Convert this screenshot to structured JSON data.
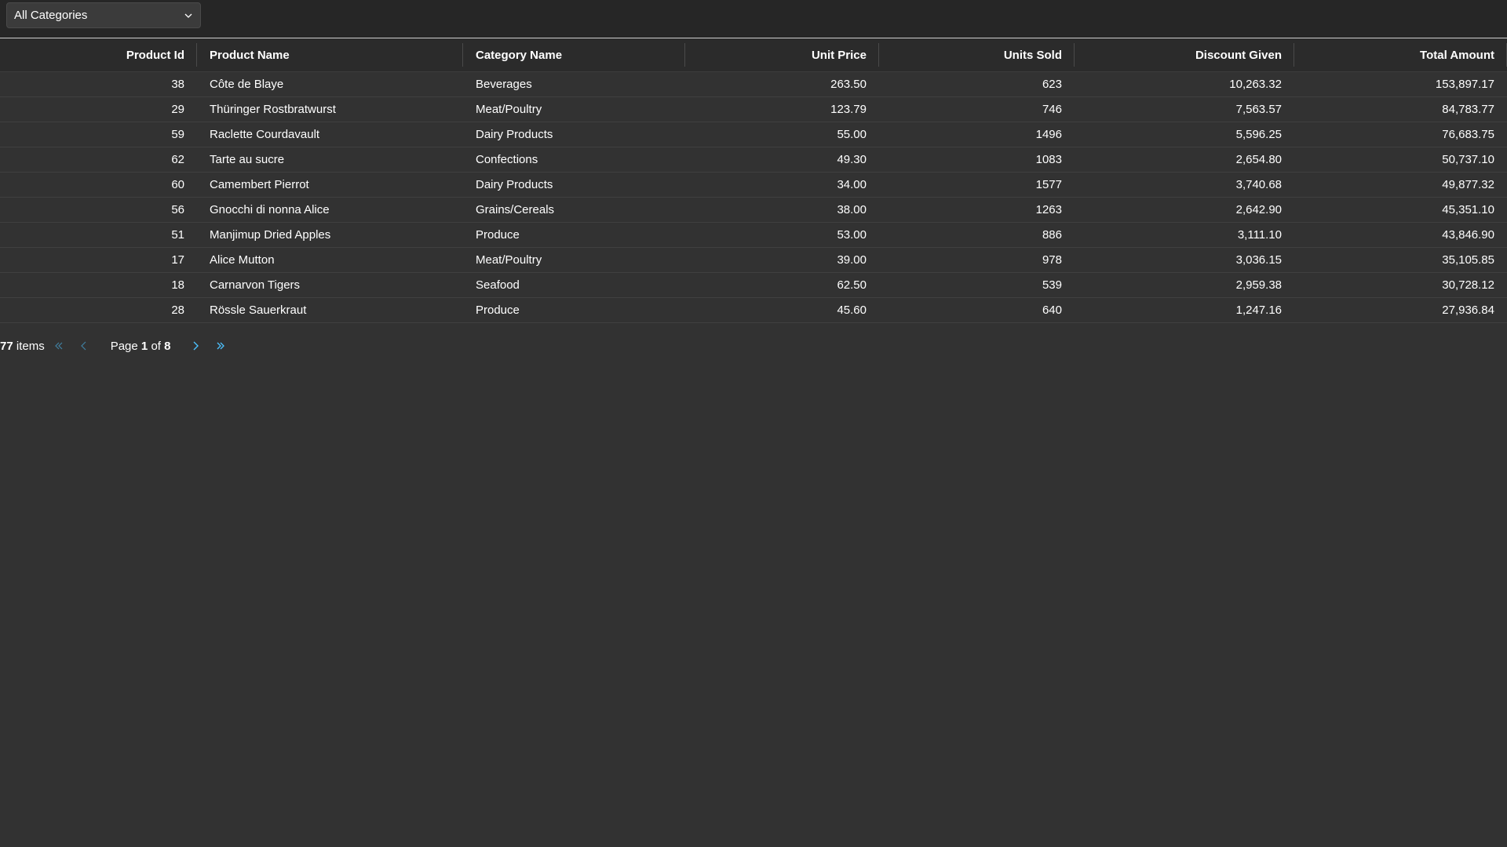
{
  "filter": {
    "selected": "All Categories"
  },
  "grid": {
    "columns": {
      "product_id": "Product Id",
      "product_name": "Product Name",
      "category_name": "Category Name",
      "unit_price": "Unit Price",
      "units_sold": "Units Sold",
      "discount_given": "Discount Given",
      "total_amount": "Total Amount"
    },
    "rows": [
      {
        "id": "38",
        "name": "Côte de Blaye",
        "category": "Beverages",
        "price": "263.50",
        "units": "623",
        "discount": "10,263.32",
        "total": "153,897.17"
      },
      {
        "id": "29",
        "name": "Thüringer Rostbratwurst",
        "category": "Meat/Poultry",
        "price": "123.79",
        "units": "746",
        "discount": "7,563.57",
        "total": "84,783.77"
      },
      {
        "id": "59",
        "name": "Raclette Courdavault",
        "category": "Dairy Products",
        "price": "55.00",
        "units": "1496",
        "discount": "5,596.25",
        "total": "76,683.75"
      },
      {
        "id": "62",
        "name": "Tarte au sucre",
        "category": "Confections",
        "price": "49.30",
        "units": "1083",
        "discount": "2,654.80",
        "total": "50,737.10"
      },
      {
        "id": "60",
        "name": "Camembert Pierrot",
        "category": "Dairy Products",
        "price": "34.00",
        "units": "1577",
        "discount": "3,740.68",
        "total": "49,877.32"
      },
      {
        "id": "56",
        "name": "Gnocchi di nonna Alice",
        "category": "Grains/Cereals",
        "price": "38.00",
        "units": "1263",
        "discount": "2,642.90",
        "total": "45,351.10"
      },
      {
        "id": "51",
        "name": "Manjimup Dried Apples",
        "category": "Produce",
        "price": "53.00",
        "units": "886",
        "discount": "3,111.10",
        "total": "43,846.90"
      },
      {
        "id": "17",
        "name": "Alice Mutton",
        "category": "Meat/Poultry",
        "price": "39.00",
        "units": "978",
        "discount": "3,036.15",
        "total": "35,105.85"
      },
      {
        "id": "18",
        "name": "Carnarvon Tigers",
        "category": "Seafood",
        "price": "62.50",
        "units": "539",
        "discount": "2,959.38",
        "total": "30,728.12"
      },
      {
        "id": "28",
        "name": "Rössle Sauerkraut",
        "category": "Produce",
        "price": "45.60",
        "units": "640",
        "discount": "1,247.16",
        "total": "27,936.84"
      }
    ]
  },
  "pager": {
    "item_count": "77",
    "items_label": "items",
    "page_label": "Page",
    "current_page": "1",
    "of_label": "of",
    "total_pages": "8"
  },
  "colors": {
    "background": "#323232",
    "toolbar": "#262626",
    "accent": "#4cc2ff"
  },
  "icons": {
    "dropdown": "chevron-down-icon",
    "first": "double-chevron-left-icon",
    "previous": "chevron-left-icon",
    "next": "chevron-right-icon",
    "last": "double-chevron-right-icon"
  }
}
